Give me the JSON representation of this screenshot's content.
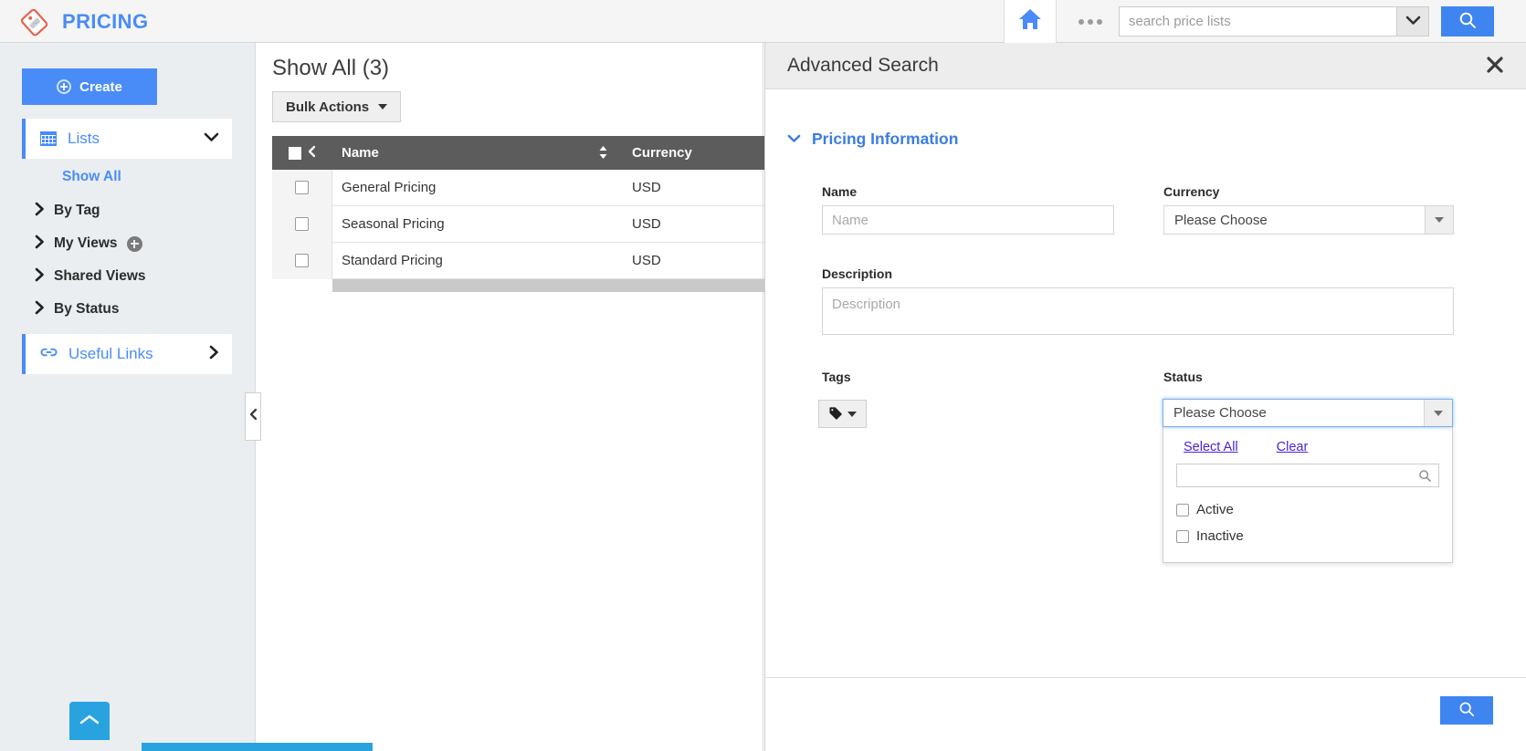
{
  "topbar": {
    "brand_title": "PRICING",
    "brand_icon": "price-tag-icon",
    "home_icon": "home-icon",
    "more_icon": "more-dots-icon",
    "search_value": "",
    "search_placeholder": "search price lists",
    "search_dropdown_icon": "chevron-down-icon",
    "search_button_icon": "search-icon"
  },
  "sidebar": {
    "create_label": "Create",
    "create_icon": "plus-circle-icon",
    "lists": {
      "label": "Lists",
      "icon": "grid-icon",
      "chevron": "chevron-down-icon"
    },
    "items": [
      {
        "label": "Show All",
        "active": true
      },
      {
        "label": "By Tag",
        "active": false
      },
      {
        "label": "My Views",
        "active": false,
        "has_add": true
      },
      {
        "label": "Shared Views",
        "active": false
      },
      {
        "label": "By Status",
        "active": false
      }
    ],
    "useful_links": {
      "label": "Useful Links",
      "icon": "link-icon",
      "chevron": "chevron-right-icon"
    },
    "scroll_top_icon": "chevron-up-icon"
  },
  "list_panel": {
    "title": "Show All (3)",
    "bulk_actions_label": "Bulk Actions",
    "bulk_actions_caret": "caret-down-icon",
    "collapse_icon": "chevron-left-icon",
    "columns": [
      "Name",
      "Currency"
    ],
    "sort_icon": "sort-updown-icon",
    "rows": [
      {
        "name": "General Pricing",
        "currency": "USD"
      },
      {
        "name": "Seasonal Pricing",
        "currency": "USD"
      },
      {
        "name": "Standard Pricing",
        "currency": "USD"
      }
    ]
  },
  "advanced_search": {
    "title": "Advanced Search",
    "close_icon": "close-icon",
    "section": {
      "label": "Pricing Information",
      "toggle_icon": "chevron-down-icon"
    },
    "name": {
      "label": "Name",
      "value": "",
      "placeholder": "Name"
    },
    "currency": {
      "label": "Currency",
      "value": "Please Choose",
      "arrow_icon": "caret-down-icon"
    },
    "description": {
      "label": "Description",
      "value": "",
      "placeholder": "Description"
    },
    "tags": {
      "label": "Tags",
      "button_icon": "tag-icon",
      "caret_icon": "caret-down-icon"
    },
    "status": {
      "label": "Status",
      "value": "Please Choose",
      "arrow_icon": "caret-down-icon",
      "select_all_label": "Select All",
      "clear_label": "Clear",
      "filter_value": "",
      "filter_icon": "search-icon",
      "options": [
        {
          "label": "Active",
          "checked": false
        },
        {
          "label": "Inactive",
          "checked": false
        }
      ]
    },
    "footer_search_icon": "search-icon"
  },
  "colors": {
    "brand_blue": "#4a8cf7",
    "accent_blue": "#3f85f0",
    "link_purple": "#4b22d6",
    "sidebar_bg": "#eaeef1",
    "header_dark": "#5c5c5c",
    "bottom_bar": "#29a3e0"
  }
}
